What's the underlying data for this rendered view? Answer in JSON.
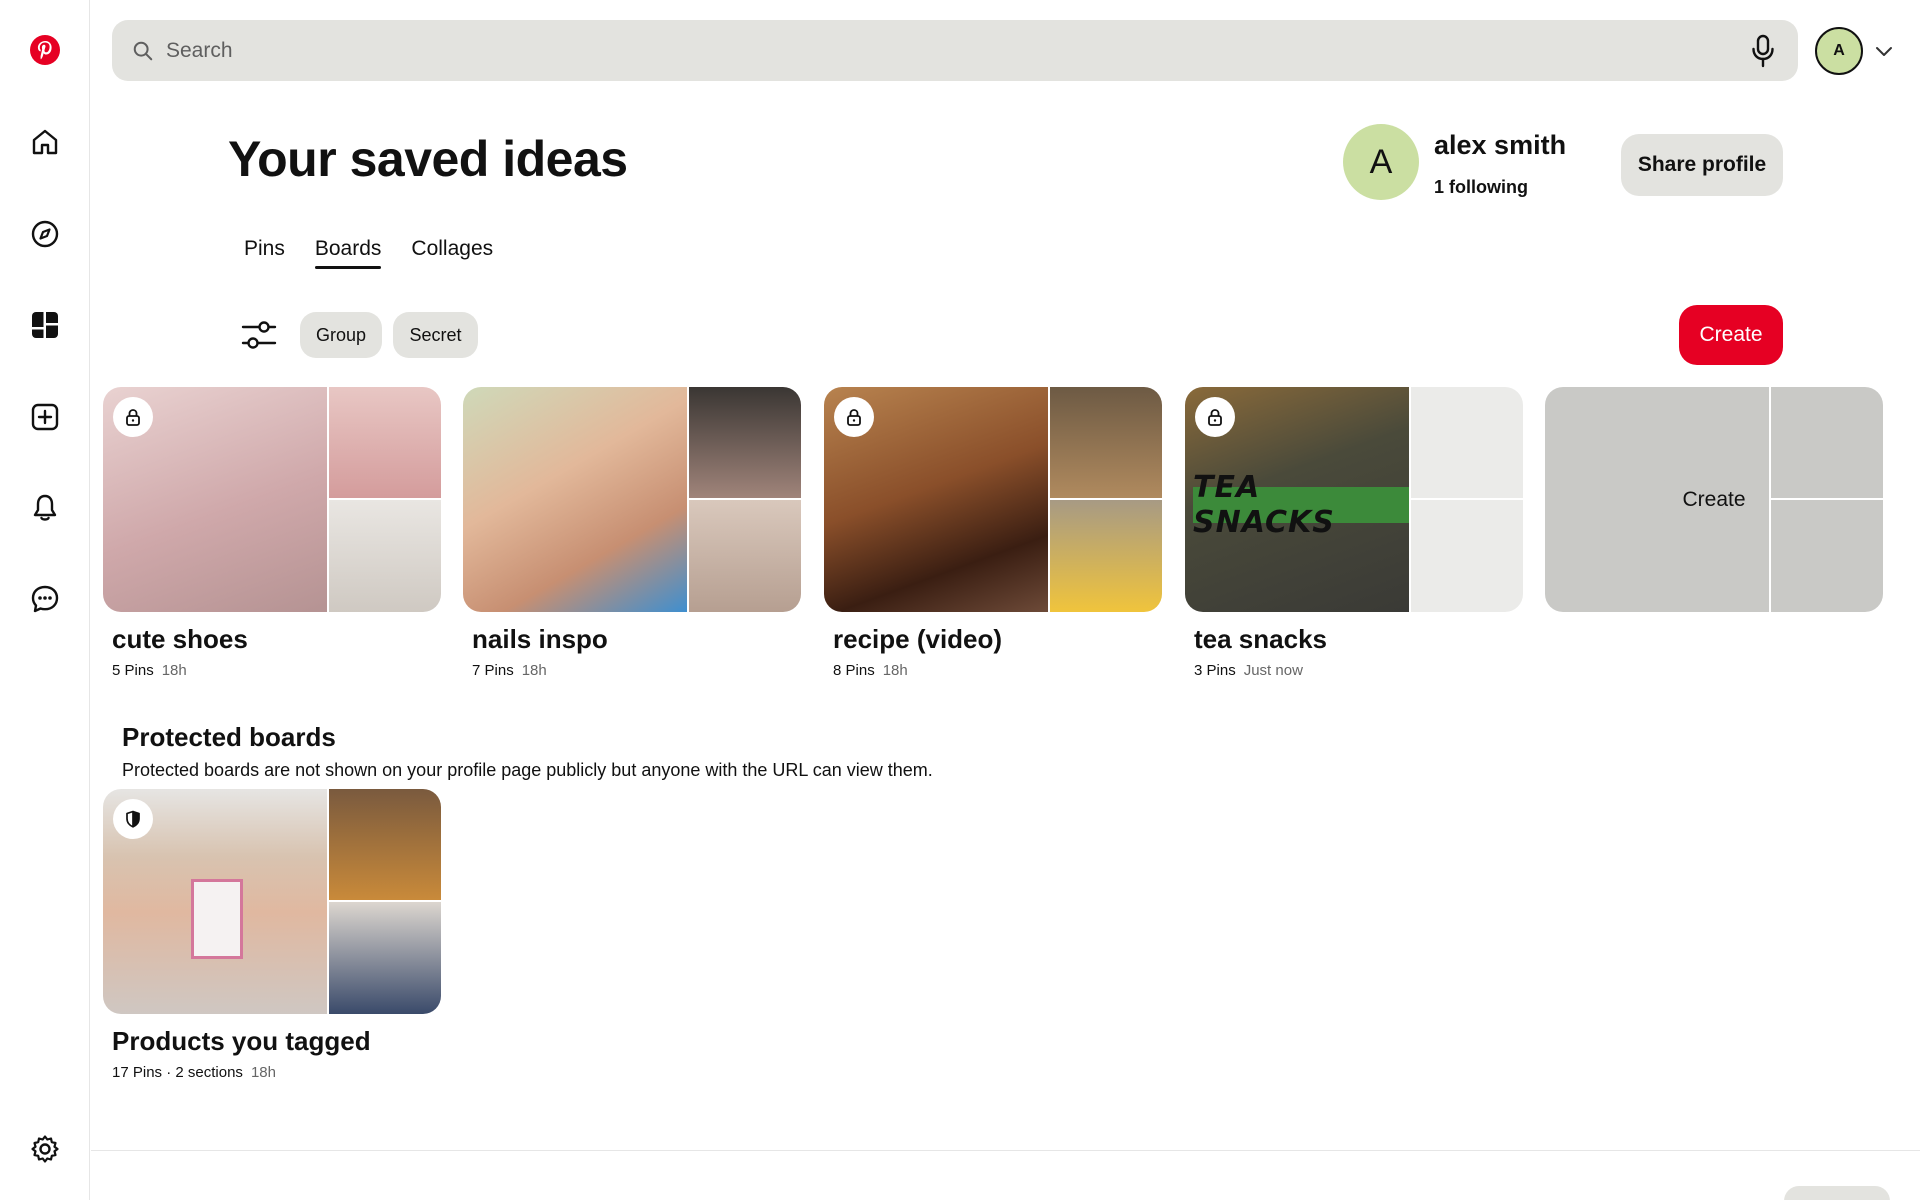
{
  "app": {
    "brand_color": "#e60023"
  },
  "sidebar": {
    "items": [
      {
        "name": "pinterest-logo",
        "icon": "pinterest-logo"
      },
      {
        "name": "home",
        "icon": "home-icon"
      },
      {
        "name": "explore",
        "icon": "compass-icon"
      },
      {
        "name": "boards",
        "icon": "boards-icon"
      },
      {
        "name": "create",
        "icon": "plus-square-icon"
      },
      {
        "name": "notifications",
        "icon": "bell-icon"
      },
      {
        "name": "messages",
        "icon": "chat-icon"
      },
      {
        "name": "settings",
        "icon": "gear-icon"
      }
    ]
  },
  "header": {
    "search_placeholder": "Search",
    "avatar_initial": "A"
  },
  "page": {
    "title": "Your saved ideas"
  },
  "profile": {
    "initial": "A",
    "name": "alex smith",
    "following": "1 following",
    "share_label": "Share profile"
  },
  "tabs": [
    {
      "label": "Pins",
      "active": false
    },
    {
      "label": "Boards",
      "active": true
    },
    {
      "label": "Collages",
      "active": false
    }
  ],
  "filters": {
    "chips": [
      "Group",
      "Secret"
    ],
    "create_label": "Create"
  },
  "boards": [
    {
      "title": "cute shoes",
      "pins": "5 Pins",
      "time": "18h",
      "secret": true,
      "colors": [
        "#d9b7b8",
        "#d9a9a8",
        "#e5e0dc"
      ]
    },
    {
      "title": "nails inspo",
      "pins": "7 Pins",
      "time": "18h",
      "secret": false,
      "colors": [
        "#d8b08e",
        "#8a7a70",
        "#c4aa9a"
      ]
    },
    {
      "title": "recipe (video)",
      "pins": "8 Pins",
      "time": "18h",
      "secret": true,
      "colors": [
        "#7a4a2a",
        "#8a6a4a",
        "#e0b84a"
      ]
    },
    {
      "title": "tea snacks",
      "pins": "3 Pins",
      "time": "Just now",
      "secret": true,
      "cover_text": "TEA SNACKS",
      "colors": [
        "#4a5038",
        "#ebebe9",
        "#ebebe9"
      ]
    }
  ],
  "create_tile": {
    "label": "Create"
  },
  "protected": {
    "heading": "Protected boards",
    "description": "Protected boards are not shown on your profile page publicly but anyone with the URL can view them.",
    "board": {
      "title": "Products you tagged",
      "pins": "17 Pins",
      "sections": "2 sections",
      "time": "18h",
      "colors": [
        "#c8c6c2",
        "#8a6e58",
        "#d8d2cc"
      ]
    }
  }
}
